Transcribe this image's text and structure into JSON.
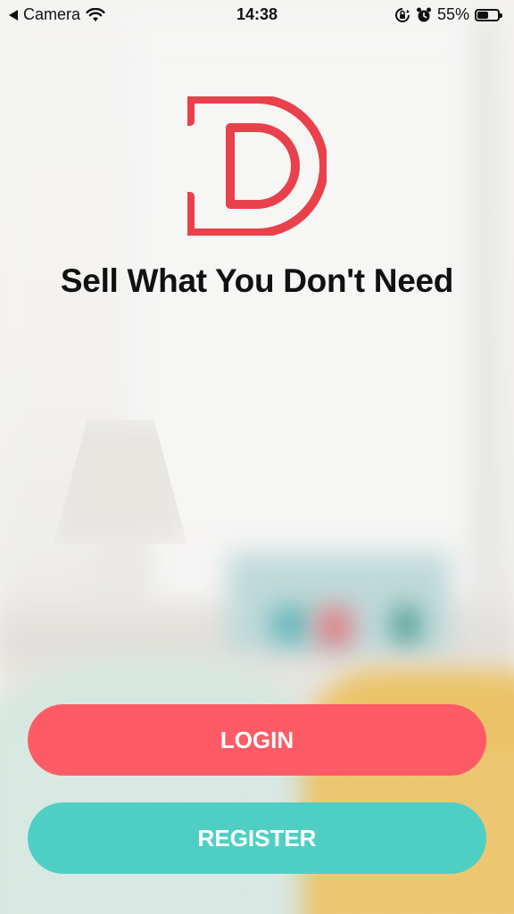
{
  "status_bar": {
    "back_app": "Camera",
    "time": "14:38",
    "battery_percent": "55%",
    "battery_level": 0.55
  },
  "app": {
    "headline": "Sell What You Don't Need",
    "logo_color": "#e8414b"
  },
  "buttons": {
    "login_label": "LOGIN",
    "login_color": "#fd5c66",
    "register_label": "REGISTER",
    "register_color": "#4fcfc4"
  },
  "icons": {
    "back": "back-arrow-icon",
    "wifi": "wifi-icon",
    "orientation_lock": "orientation-lock-icon",
    "alarm": "alarm-icon",
    "battery": "battery-icon"
  }
}
